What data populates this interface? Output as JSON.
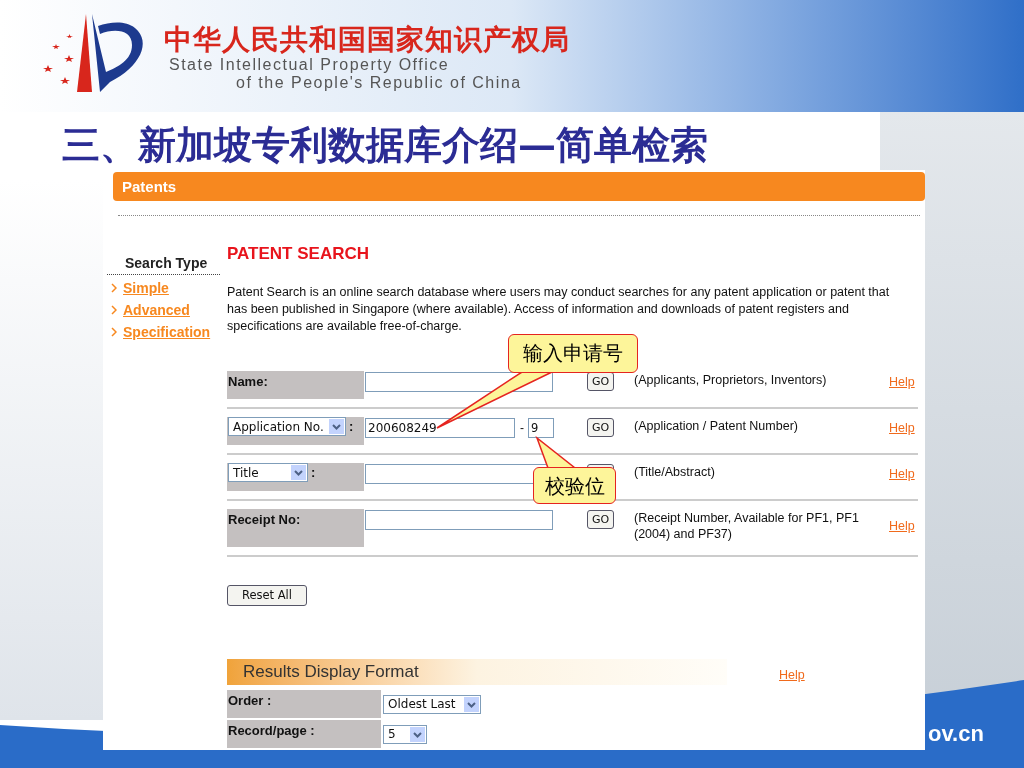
{
  "header": {
    "org_cn": "中华人民共和国国家知识产权局",
    "org_en_line1": "State Intellectual Property Office",
    "org_en_line2": "of the People's Republic of China"
  },
  "slide_title": "三、新加坡专利数据库介绍—简单检索",
  "web": {
    "banner": "Patents",
    "sidebar": {
      "heading": "Search Type",
      "links": [
        "Simple",
        "Advanced",
        "Specification"
      ]
    },
    "heading": "PATENT SEARCH",
    "intro": "Patent Search is an online search database where users may conduct searches for any patent application or patent that has been published in Singapore (where available). Access of information and downloads of patent registers and specifications are available free-of-charge.",
    "rows": [
      {
        "kind": "label",
        "label": "Name:",
        "go": "GO",
        "description": "(Applicants, Proprietors, Inventors)",
        "help": "Help"
      },
      {
        "kind": "select",
        "select_value": "Application No.",
        "colon": ":",
        "value": "200608249",
        "dash": "-",
        "check_digit": "9",
        "go": "GO",
        "description": "(Application / Patent Number)",
        "help": "Help"
      },
      {
        "kind": "select",
        "select_value": "Title",
        "colon": ":",
        "description": "(Title/Abstract)",
        "help": "Help"
      },
      {
        "kind": "label",
        "label": "Receipt No:",
        "go": "GO",
        "description": "(Receipt Number, Available for PF1, PF1 (2004) and PF37)",
        "help": "Help"
      }
    ],
    "reset_button": "Reset All",
    "results": {
      "title": "Results Display Format",
      "help": "Help",
      "fields": [
        {
          "label": "Order :",
          "value": "Oldest Last"
        },
        {
          "label": "Record/page :",
          "value": "5"
        }
      ]
    }
  },
  "callouts": [
    {
      "text": "输入申请号"
    },
    {
      "text": "校验位"
    }
  ],
  "footer_url": "ov.cn"
}
